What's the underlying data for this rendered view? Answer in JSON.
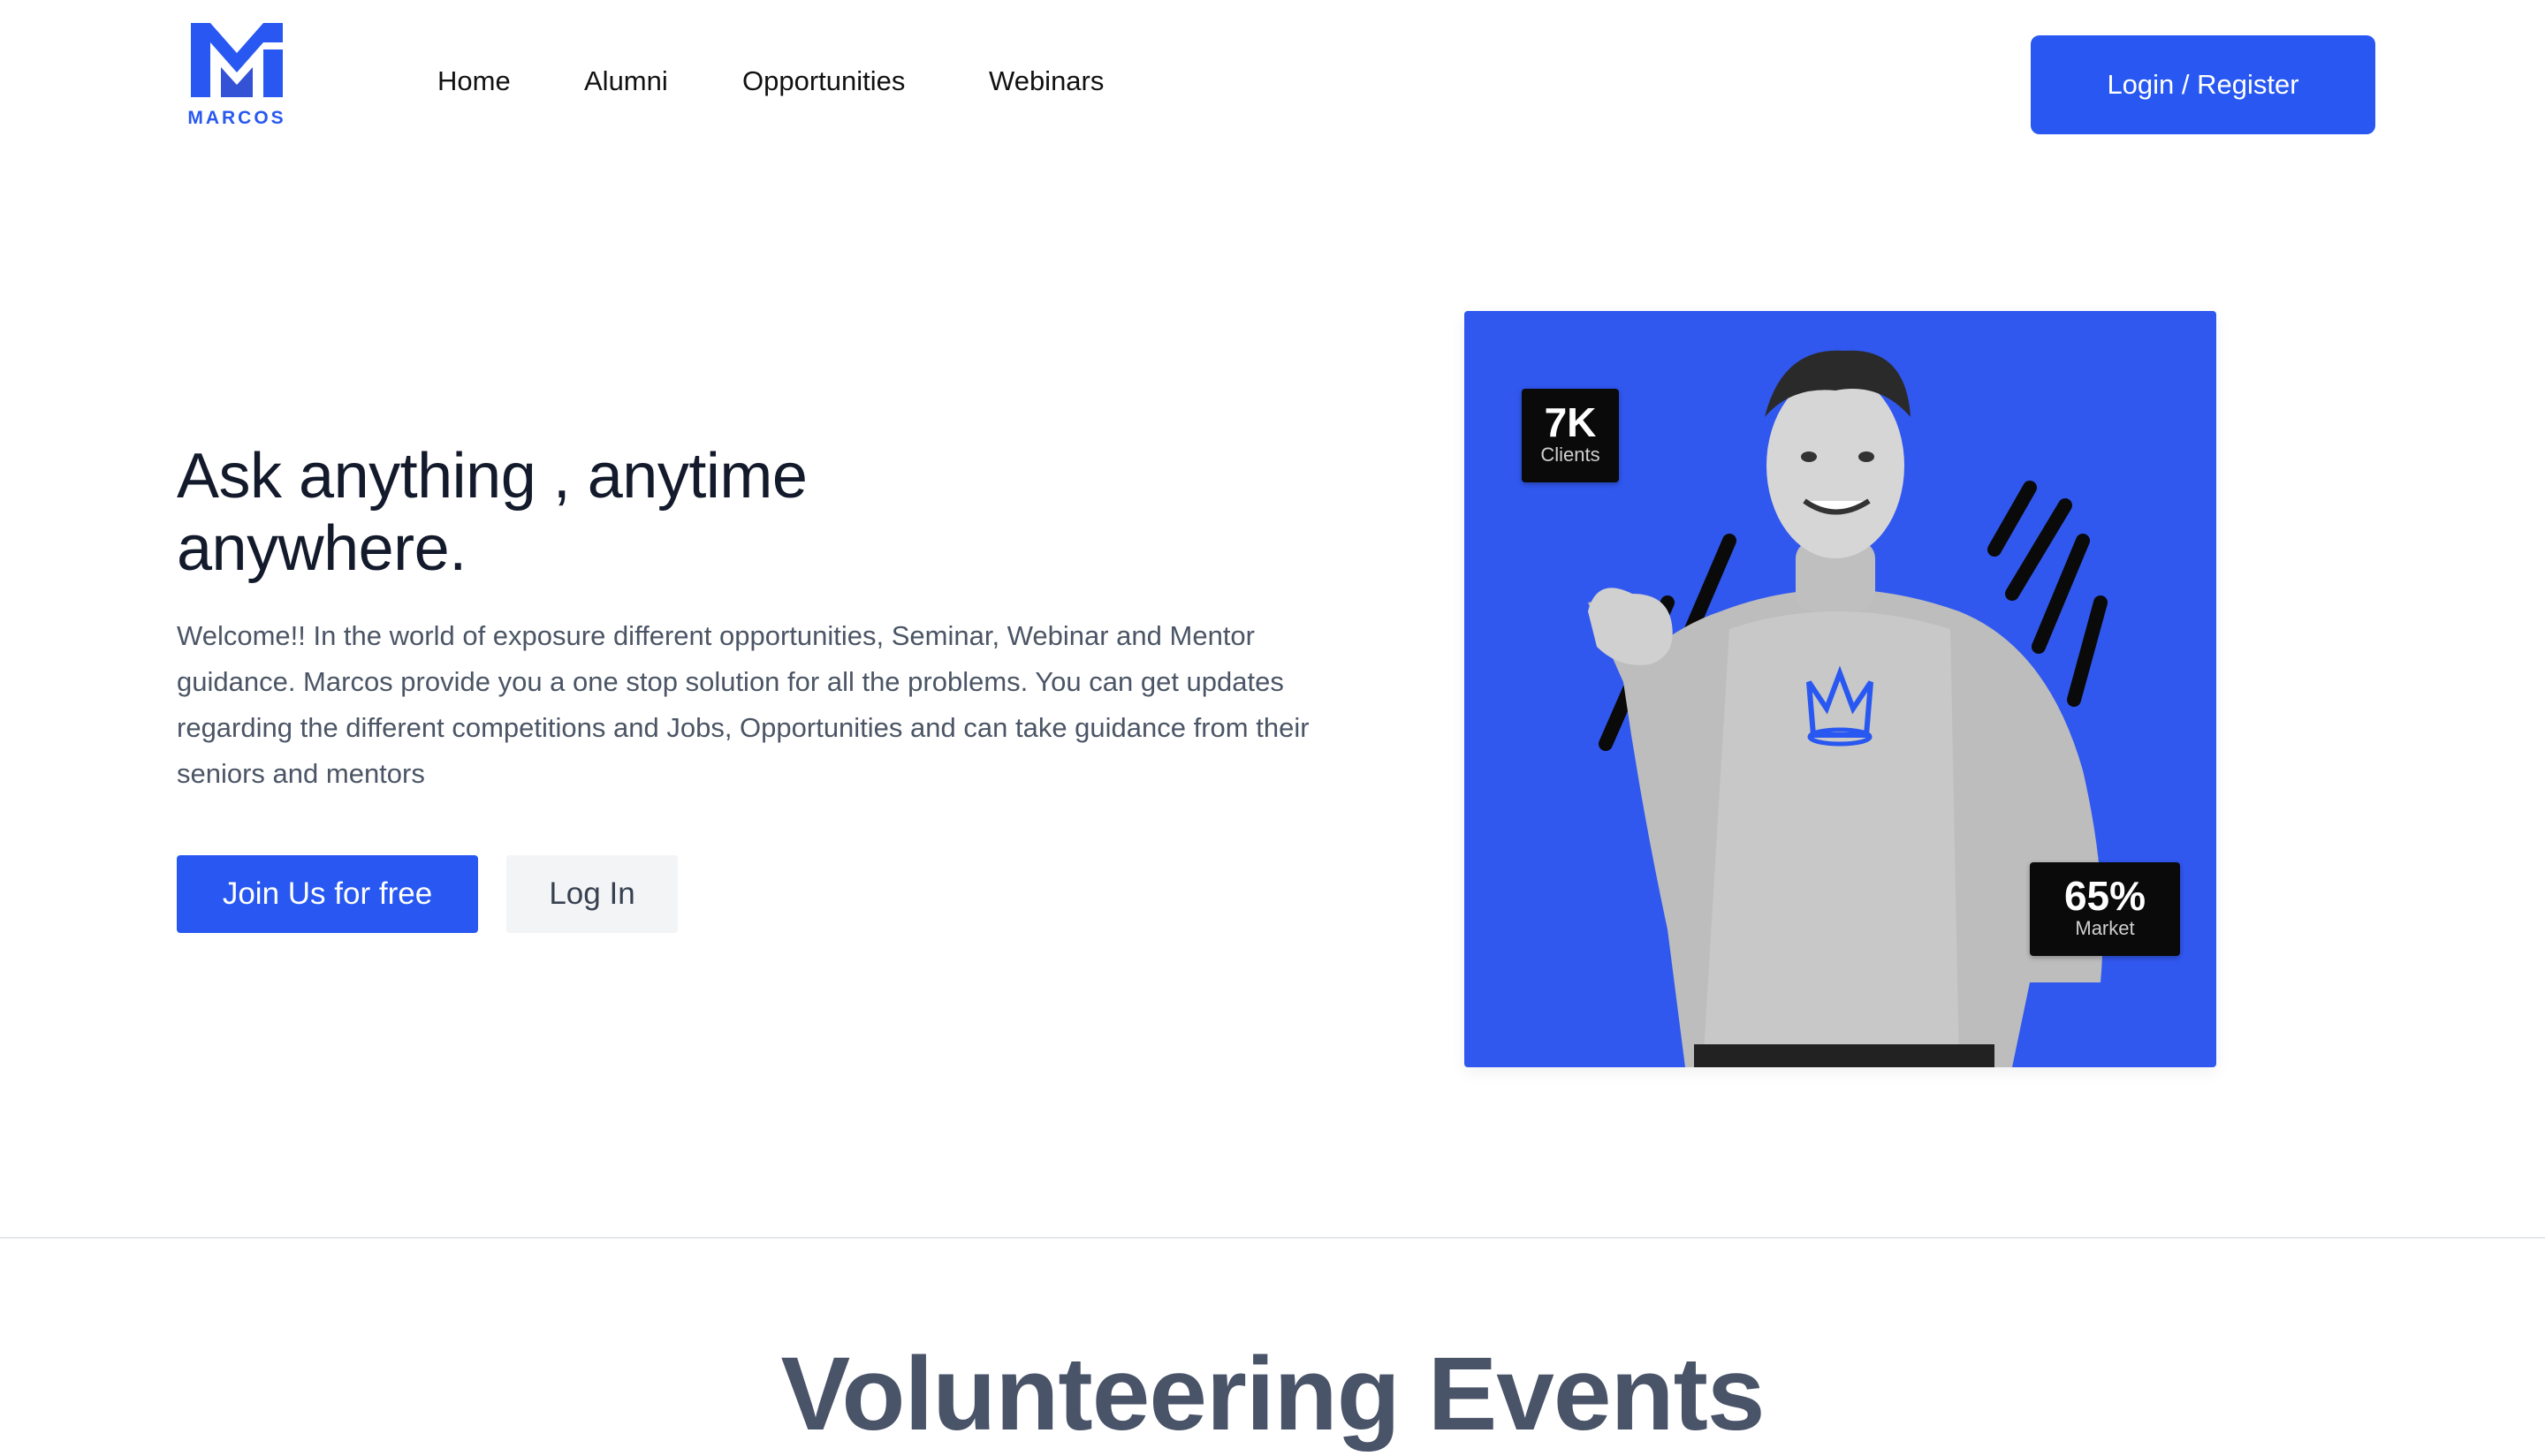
{
  "brand": {
    "name": "MARCOS",
    "accent": "#2858f1"
  },
  "nav": {
    "links": [
      "Home",
      "Alumni",
      "Opportunities",
      "Webinars"
    ],
    "login_label": "Login / Register"
  },
  "hero": {
    "title": "Ask anything , anytime anywhere.",
    "description": "Welcome!! In the world of exposure different opportunities, Seminar, Webinar and Mentor guidance. Marcos provide you a one stop solution for all the problems. You can get updates regarding the different competitions and Jobs, Opportunities and can take guidance from their seniors and mentors",
    "primary_button": "Join Us for free",
    "secondary_button": "Log In",
    "image": {
      "background": "#3058ef",
      "stats": [
        {
          "value": "7K",
          "label": "Clients"
        },
        {
          "value": "65%",
          "label": "Market"
        }
      ]
    }
  },
  "section": {
    "title": "Volunteering Events"
  }
}
